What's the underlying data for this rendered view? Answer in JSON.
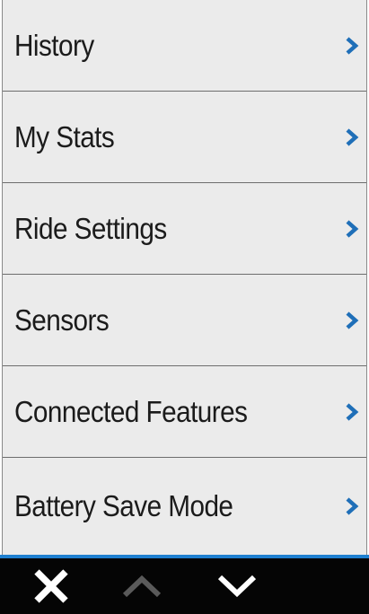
{
  "menu": {
    "items": [
      {
        "label": "History"
      },
      {
        "label": "My Stats"
      },
      {
        "label": "Ride Settings"
      },
      {
        "label": "Sensors"
      },
      {
        "label": "Connected Features"
      },
      {
        "label": "Battery Save Mode"
      }
    ],
    "item_icon": "chevron-right-icon"
  },
  "toolbar": {
    "buttons": [
      {
        "icon": "close-icon",
        "enabled": true
      },
      {
        "icon": "chevron-up-icon",
        "enabled": false
      },
      {
        "icon": "chevron-down-icon",
        "enabled": true
      }
    ]
  },
  "colors": {
    "background": "#ebebeb",
    "text": "#1b1b1b",
    "chevron": "#1f6fb8",
    "accent_bar": "#1e7fd0",
    "toolbar": "#050505",
    "toolbar_icon": "#ffffff",
    "toolbar_icon_disabled": "#5a5a5a",
    "divider": "#6d6d6d"
  }
}
